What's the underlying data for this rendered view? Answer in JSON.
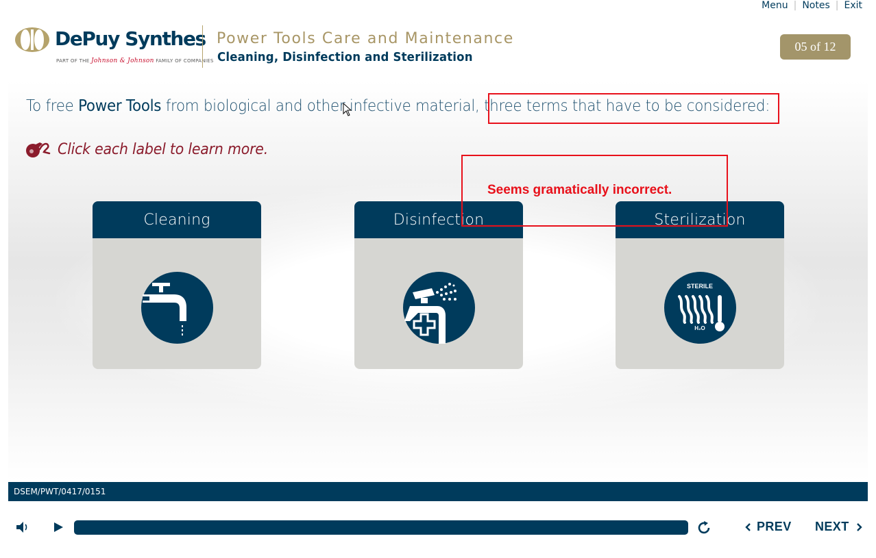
{
  "top_links": {
    "menu": "Menu",
    "notes": "Notes",
    "exit": "Exit",
    "separator": "|"
  },
  "brand": {
    "logo_text": "DePuy Synthes",
    "logo_sub_prefix": "PART OF THE",
    "logo_sub_jj": "Johnson & Johnson",
    "logo_sub_suffix": "FAMILY OF COMPANIES"
  },
  "header": {
    "course_title": "Power Tools Care and Maintenance",
    "course_subtitle": "Cleaning, Disinfection and Sterilization",
    "page_indicator": "05 of 12"
  },
  "content": {
    "intro_prefix": "To free ",
    "intro_bold": "Power Tools",
    "intro_suffix": " from biological and other infective material, three terms that have to be considered:",
    "instruction": "Click each label to learn more."
  },
  "cards": [
    {
      "label": "Cleaning",
      "icon": "faucet-icon"
    },
    {
      "label": "Disinfection",
      "icon": "disinfection-spray-icon"
    },
    {
      "label": "Sterilization",
      "icon": "sterile-steam-icon",
      "icon_text_top": "STERILE",
      "icon_text_bottom": "H₂O"
    }
  ],
  "annotation": {
    "comment": "Seems gramatically incorrect.",
    "color": "#e8101a"
  },
  "footer": {
    "course_code": "DSEM/PWT/0417/0151",
    "prev_label": "PREV",
    "next_label": "NEXT"
  },
  "colors": {
    "navy": "#003b5c",
    "gold": "#a89666",
    "badge": "#a3956a",
    "card_bg": "#d6d6d2",
    "instruction": "#8b1c2c"
  }
}
